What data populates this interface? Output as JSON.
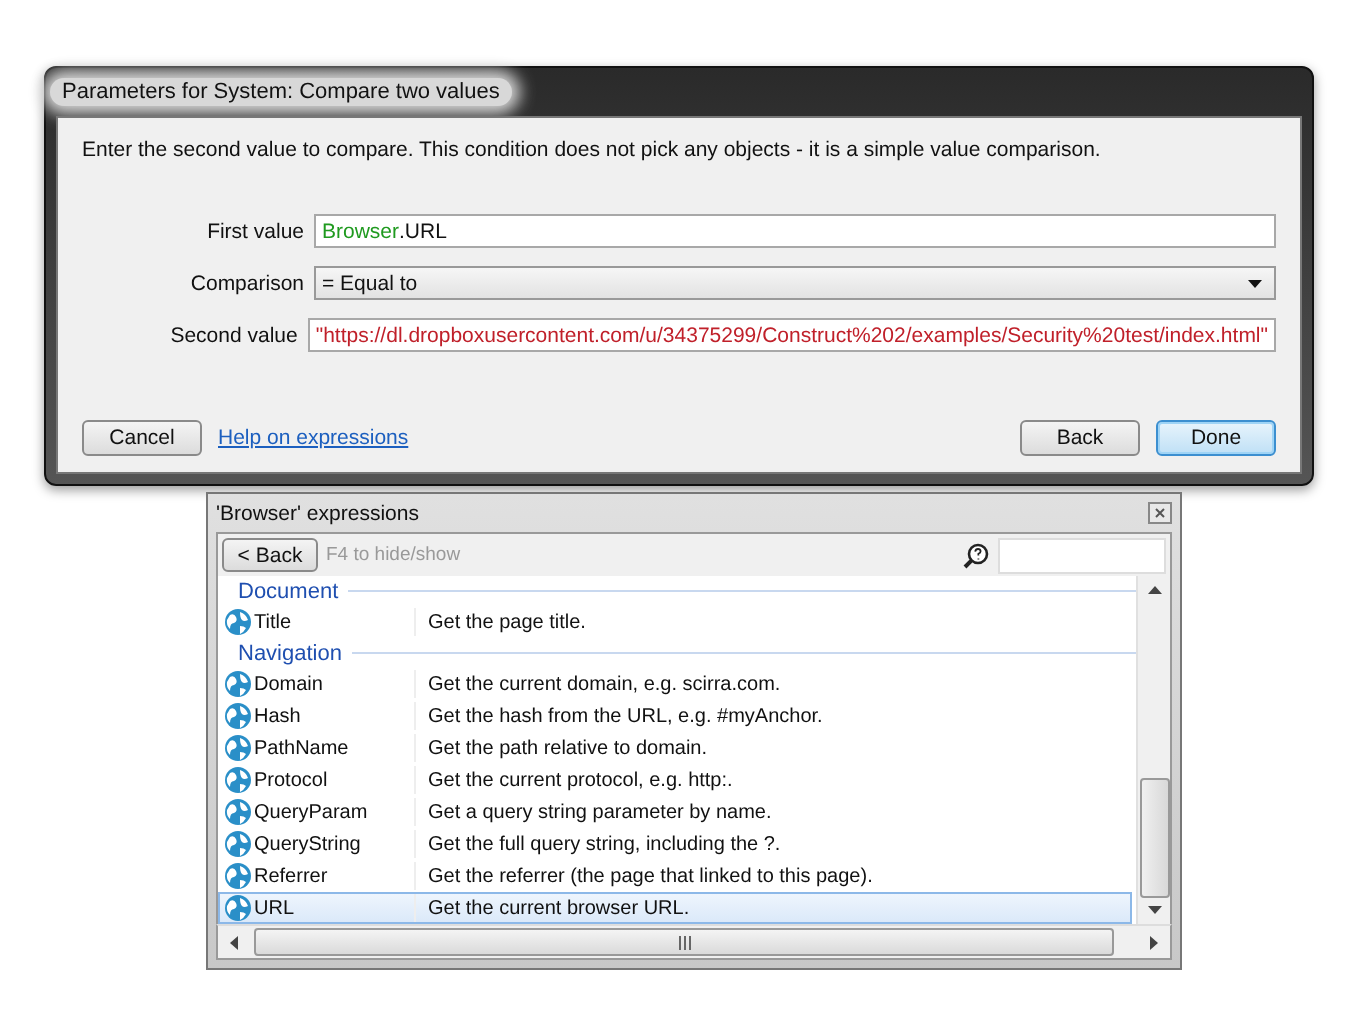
{
  "dialog": {
    "title": "Parameters for System: Compare two values",
    "intro": "Enter the second value to compare.  This condition does not pick any objects - it is a simple value comparison.",
    "fields": [
      {
        "kind": "expression",
        "label": "First value",
        "parts": [
          {
            "kind": "object",
            "text": "Browser"
          },
          {
            "kind": "plain",
            "text": ".URL"
          }
        ]
      },
      {
        "kind": "dropdown",
        "label": "Comparison",
        "parts": [
          {
            "kind": "plain",
            "text": "= Equal to"
          }
        ]
      },
      {
        "kind": "expression",
        "label": "Second value",
        "parts": [
          {
            "kind": "string",
            "text": "\"https://dl.dropboxusercontent.com/u/34375299/Construct%202/examples/Security%20test/index.html\""
          }
        ]
      }
    ],
    "left_actions": [
      {
        "kind": "button",
        "label": "Cancel",
        "focused": false
      },
      {
        "kind": "link",
        "label": "Help on expressions",
        "focused": false
      }
    ],
    "right_actions": [
      {
        "kind": "button",
        "label": "Back",
        "focused": false
      },
      {
        "kind": "button",
        "label": "Done",
        "focused": true
      }
    ]
  },
  "panel": {
    "title": "'Browser' expressions",
    "back_button": "< Back",
    "hint": "F4 to hide/show",
    "groups": [
      {
        "name": "Document",
        "items": [
          {
            "name": "Title",
            "description": "Get the page title.",
            "selected": false
          }
        ]
      },
      {
        "name": "Navigation",
        "items": [
          {
            "name": "Domain",
            "description": "Get the current domain, e.g. scirra.com.",
            "selected": false
          },
          {
            "name": "Hash",
            "description": "Get the hash from the URL, e.g. #myAnchor.",
            "selected": false
          },
          {
            "name": "PathName",
            "description": "Get the path relative to domain.",
            "selected": false
          },
          {
            "name": "Protocol",
            "description": "Get the current protocol, e.g. http:.",
            "selected": false
          },
          {
            "name": "QueryParam",
            "description": "Get a query string parameter by name.",
            "selected": false
          },
          {
            "name": "QueryString",
            "description": "Get the full query string, including the ?.",
            "selected": false
          },
          {
            "name": "Referrer",
            "description": "Get the referrer (the page that linked to this page).",
            "selected": false
          },
          {
            "name": "URL",
            "description": "Get the current browser URL.",
            "selected": true
          }
        ]
      }
    ]
  }
}
